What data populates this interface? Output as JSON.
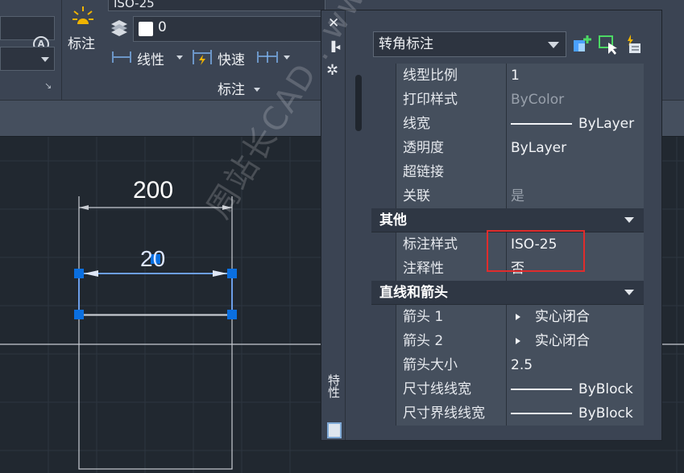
{
  "ribbon": {
    "dim_style": "ISO-25",
    "annotate_label": "标注",
    "layer_value": "0",
    "linear_label": "线性",
    "quick_label": "快速",
    "panel_title": "标注"
  },
  "drawing": {
    "dim_outer": "200",
    "dim_selected": "20"
  },
  "palette": {
    "object_type": "转角标注",
    "side_label": "特性",
    "rows_general": [
      {
        "name": "线型比例",
        "value": "1"
      },
      {
        "name": "打印样式",
        "value": "ByColor"
      },
      {
        "name": "线宽",
        "value": "ByLayer"
      },
      {
        "name": "透明度",
        "value": "ByLayer"
      },
      {
        "name": "超链接",
        "value": ""
      },
      {
        "name": "关联",
        "value": "是"
      }
    ],
    "cat_misc": "其他",
    "rows_misc": [
      {
        "name": "标注样式",
        "value": "ISO-25"
      },
      {
        "name": "注释性",
        "value": "否"
      }
    ],
    "cat_lines": "直线和箭头",
    "rows_lines": [
      {
        "name": "箭头 1",
        "value": "实心闭合"
      },
      {
        "name": "箭头 2",
        "value": "实心闭合"
      },
      {
        "name": "箭头大小",
        "value": "2.5"
      },
      {
        "name": "尺寸线线宽",
        "value": "ByBlock"
      },
      {
        "name": "尺寸界线线宽",
        "value": "ByBlock"
      }
    ]
  },
  "watermark": "周站长CAD . www.zzzcad.com",
  "colors": {
    "ribbon": "#3b4453",
    "canvas": "#212830",
    "highlight": "#e02c2c",
    "grip": "#0a6fe0"
  }
}
